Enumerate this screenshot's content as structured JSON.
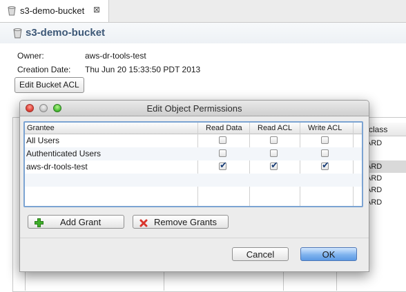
{
  "tab": {
    "title": "s3-demo-bucket",
    "close_glyph": "⊠"
  },
  "header": {
    "title": "s3-demo-bucket"
  },
  "info": {
    "owner_label": "Owner:",
    "owner_value": "aws-dr-tools-test",
    "creation_label": "Creation Date:",
    "creation_value": "Thu Jun 20 15:33:50 PDT 2013",
    "edit_acl_button": "Edit Bucket ACL"
  },
  "background_table": {
    "column_header_partial": "class",
    "cells": [
      "ARD",
      "ARD",
      "ARD",
      "ARD",
      "ARD"
    ]
  },
  "dialog": {
    "title": "Edit Object Permissions",
    "columns": [
      "Grantee",
      "Read Data",
      "Read ACL",
      "Write ACL"
    ],
    "rows": [
      {
        "grantee": "All Users",
        "read_data": false,
        "read_acl": false,
        "write_acl": false
      },
      {
        "grantee": "Authenticated Users",
        "read_data": false,
        "read_acl": false,
        "write_acl": false
      },
      {
        "grantee": "aws-dr-tools-test",
        "read_data": true,
        "read_acl": true,
        "write_acl": true
      }
    ],
    "add_grant_button": "Add Grant",
    "remove_grants_button": "Remove Grants",
    "cancel_button": "Cancel",
    "ok_button": "OK",
    "check_glyph": "✔"
  },
  "colors": {
    "header_title": "#3d5877",
    "selection_border": "#7ba3d2",
    "ok_button": "#5b99e4",
    "add_icon": "#3fae2a",
    "remove_icon": "#d9342b"
  },
  "icons": [
    "bucket-icon",
    "close-icon",
    "plus-icon",
    "x-icon",
    "close-window-icon",
    "minimize-window-icon",
    "zoom-window-icon"
  ]
}
